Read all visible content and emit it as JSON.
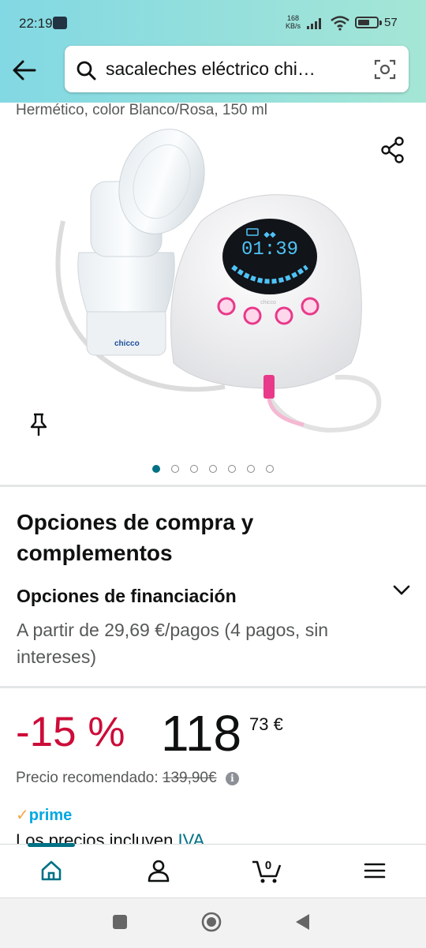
{
  "status": {
    "time": "22:19",
    "net_speed_value": "168",
    "net_speed_unit": "KB/s",
    "battery": "57"
  },
  "search": {
    "query": "sacaleches eléctrico chi…"
  },
  "product": {
    "subtitle": "Hermético, color Blanco/Rosa, 150 ml",
    "image_text": {
      "display_time": "01:39",
      "brand_base": "chicco",
      "brand_unit": "chicco"
    },
    "carousel_count": 7,
    "carousel_active": 0
  },
  "options": {
    "heading": "Opciones de compra y complementos",
    "financing_title": "Opciones de financiación",
    "financing_text": "A partir de 29,69 €/pagos (4 pagos, sin intereses)"
  },
  "price": {
    "discount": "-15 %",
    "whole": "118",
    "fraction": "73",
    "currency": "€",
    "recommended_label": "Precio recomendado:",
    "recommended_value": "139,90€",
    "prime_check": "✓",
    "prime_label": "prime",
    "tax_text": "Los precios incluyen ",
    "tax_link": "IVA"
  },
  "cart": {
    "count": "0"
  },
  "colors": {
    "accent": "#007185",
    "discount": "#cc0c39",
    "prime": "#00a8e1",
    "header_gradient_start": "#82d8e3",
    "header_gradient_end": "#a5e6d6"
  },
  "icons": {
    "back": "arrow-left-icon",
    "search": "magnifier-icon",
    "camera": "camera-search-icon",
    "share": "share-icon",
    "pin": "pin-icon",
    "chevron": "chevron-down-icon",
    "home": "home-icon",
    "account": "person-icon",
    "cart": "cart-icon",
    "menu": "hamburger-icon"
  }
}
